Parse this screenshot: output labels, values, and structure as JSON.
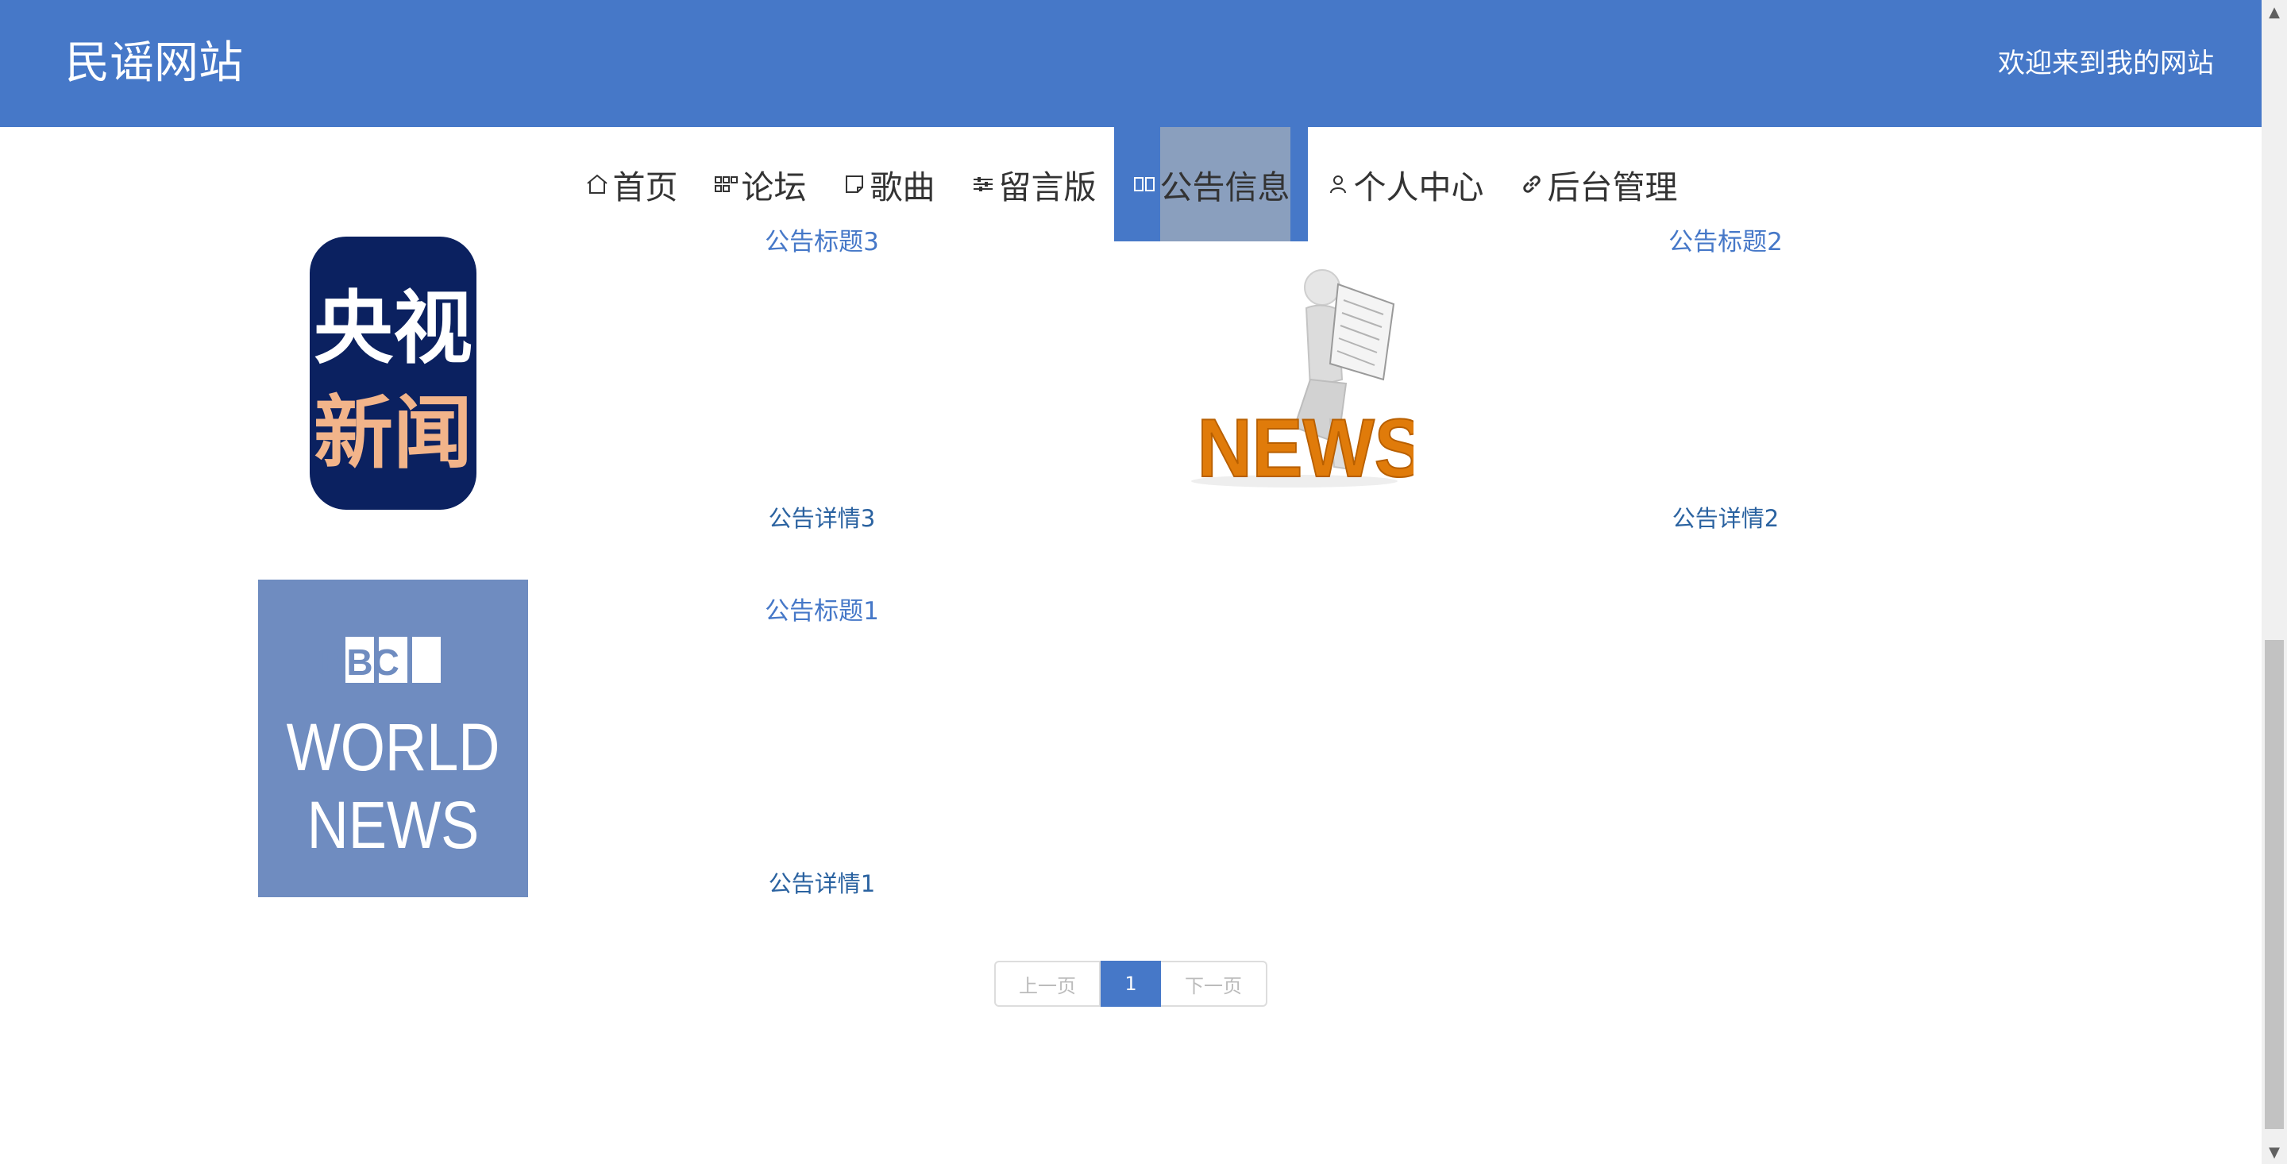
{
  "header": {
    "site_title": "民谣网站",
    "welcome": "欢迎来到我的网站"
  },
  "nav": [
    {
      "label": "首页",
      "icon": "home-icon"
    },
    {
      "label": "论坛",
      "icon": "grid-icon"
    },
    {
      "label": "歌曲",
      "icon": "note-icon"
    },
    {
      "label": "留言版",
      "icon": "sliders-icon"
    },
    {
      "label": "公告信息",
      "icon": "book-icon",
      "active": true
    },
    {
      "label": "个人中心",
      "icon": "user-icon"
    },
    {
      "label": "后台管理",
      "icon": "link-icon"
    }
  ],
  "announcements": [
    {
      "title": "公告标题3",
      "detail": "公告详情3",
      "image": "cctv-news-logo",
      "image_text_top": "央视",
      "image_text_bottom": "新闻"
    },
    {
      "title": "公告标题2",
      "detail": "公告详情2",
      "image": "news-figure",
      "image_text": "NEWS"
    },
    {
      "title": "公告标题1",
      "detail": "公告详情1",
      "image": "bbc-world-news-logo",
      "image_text_1": "BBC",
      "image_text_2": "WORLD",
      "image_text_3": "NEWS"
    }
  ],
  "pagination": {
    "prev": "上一页",
    "current": "1",
    "next": "下一页"
  },
  "colors": {
    "primary": "#4678c8",
    "active_overlay": "#8a9fbe",
    "link": "#2a62a0",
    "bbc_bg": "#6f8cc0",
    "cctv_bg": "#0b2160",
    "cctv_accent": "#f2b48a",
    "news_orange": "#e07b0a"
  }
}
